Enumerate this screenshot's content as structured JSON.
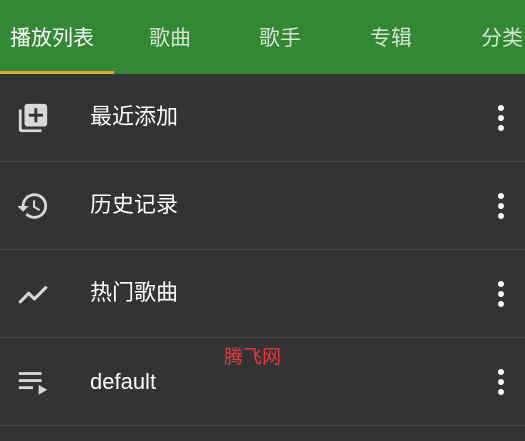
{
  "tabs": [
    {
      "label": "播放列表",
      "active": true
    },
    {
      "label": "歌曲",
      "active": false
    },
    {
      "label": "歌手",
      "active": false
    },
    {
      "label": "专辑",
      "active": false
    },
    {
      "label": "分类",
      "active": false
    }
  ],
  "playlists": [
    {
      "label": "最近添加",
      "icon": "playlist-add-icon"
    },
    {
      "label": "历史记录",
      "icon": "history-icon"
    },
    {
      "label": "热门歌曲",
      "icon": "trending-up-icon"
    },
    {
      "label": "default",
      "icon": "queue-music-icon"
    }
  ],
  "watermark": "腾飞网",
  "colors": {
    "toolbar": "#338933",
    "indicator": "#e8a53a",
    "background": "#333333",
    "divider": "#474747",
    "icon": "#d8d8d8",
    "watermark": "#e83a3a"
  }
}
